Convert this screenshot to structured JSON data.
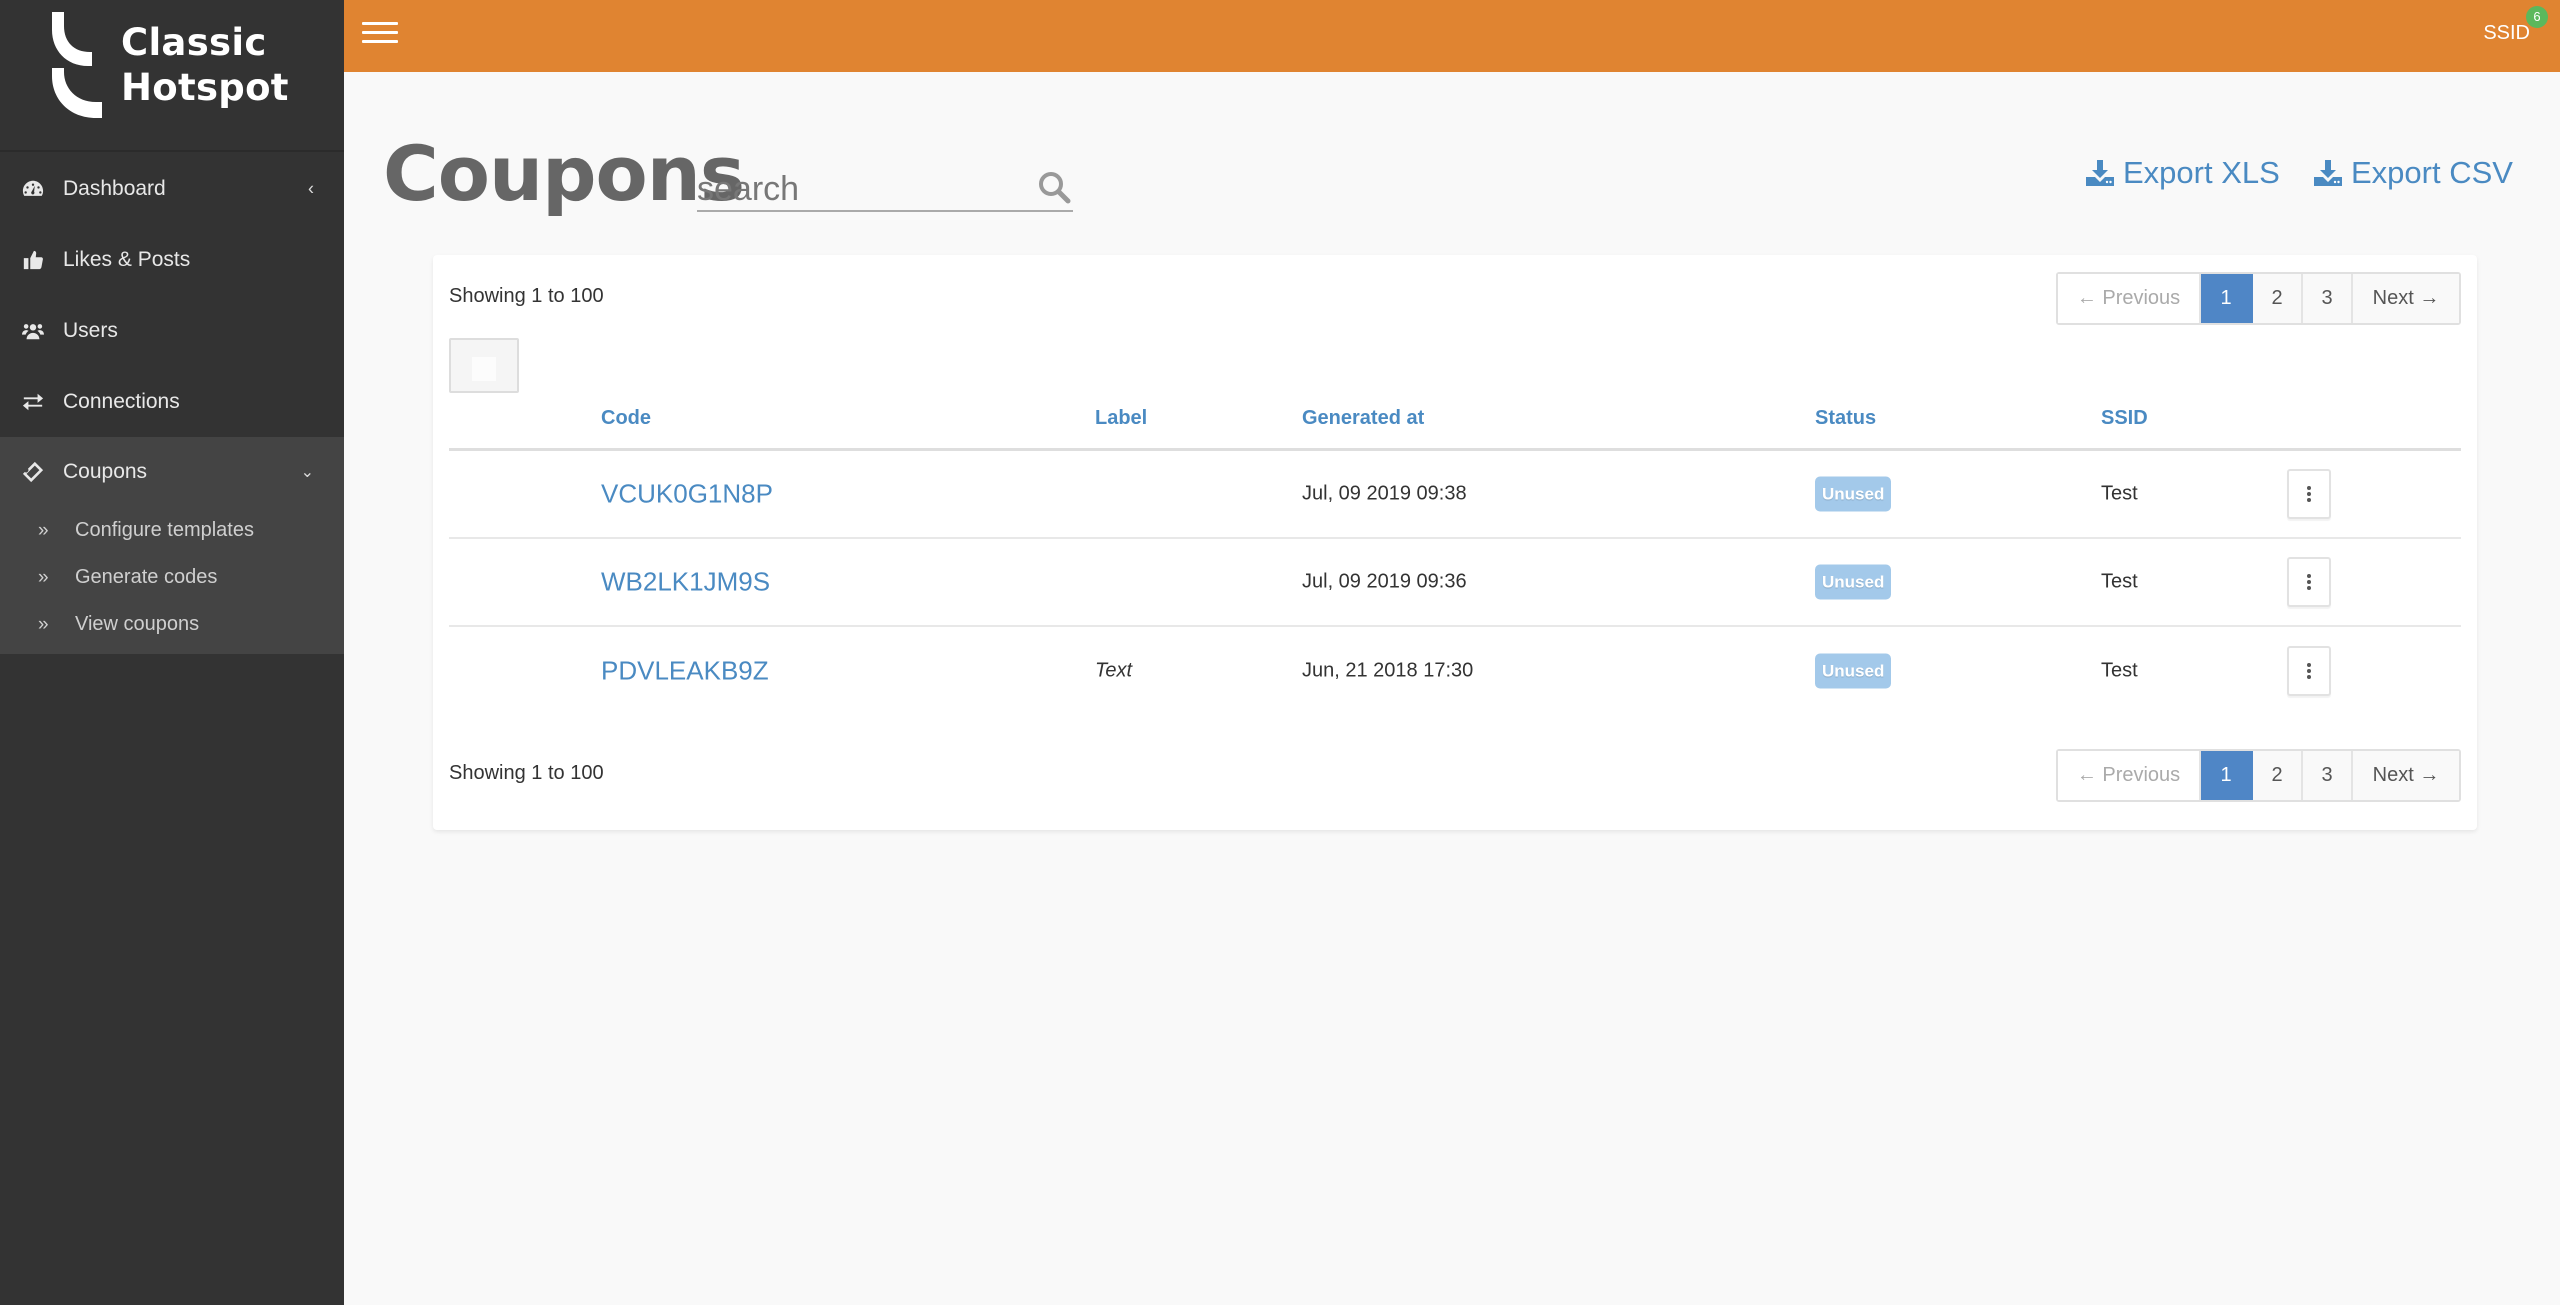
{
  "brand": {
    "line1": "Classic",
    "line2": "Hotspot"
  },
  "sidebar": {
    "items": [
      {
        "label": "Dashboard",
        "icon": "dashboard-icon"
      },
      {
        "label": "Likes & Posts",
        "icon": "thumbs-up-icon"
      },
      {
        "label": "Users",
        "icon": "users-icon"
      },
      {
        "label": "Connections",
        "icon": "exchange-icon"
      }
    ],
    "active_group": {
      "label": "Coupons",
      "icon": "ticket-icon",
      "children": [
        {
          "label": "Configure templates"
        },
        {
          "label": "Generate codes"
        },
        {
          "label": "View coupons"
        }
      ]
    }
  },
  "topbar": {
    "ssid_label": "SSID",
    "ssid_count": "6",
    "accent": "#e08431"
  },
  "page": {
    "title": "Coupons",
    "search_placeholder": "search",
    "search_value": "",
    "export_xls": "Export XLS",
    "export_csv": "Export CSV"
  },
  "listing": {
    "showing_text": "Showing 1 to 100",
    "pagination": {
      "previous": "← Previous",
      "pages": [
        "1",
        "2",
        "3"
      ],
      "current": "1",
      "next": "Next →"
    },
    "columns": {
      "code": "Code",
      "label": "Label",
      "generated_at": "Generated at",
      "status": "Status",
      "ssid": "SSID"
    },
    "rows": [
      {
        "code": "VCUK0G1N8P",
        "label": "",
        "generated_at": "Jul, 09 2019 09:38",
        "status": "Unused",
        "ssid": "Test"
      },
      {
        "code": "WB2LK1JM9S",
        "label": "",
        "generated_at": "Jul, 09 2019 09:36",
        "status": "Unused",
        "ssid": "Test"
      },
      {
        "code": "PDVLEAKB9Z",
        "label": "Text",
        "generated_at": "Jun, 21 2018 17:30",
        "status": "Unused",
        "ssid": "Test"
      }
    ]
  }
}
